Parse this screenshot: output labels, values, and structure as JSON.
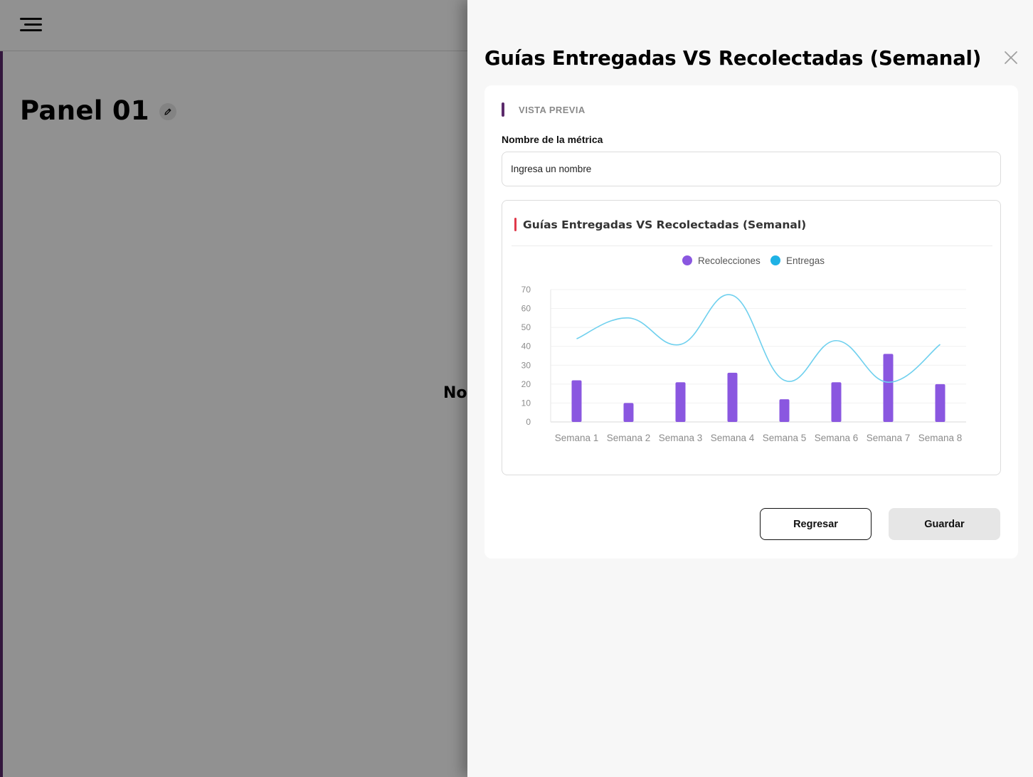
{
  "background": {
    "panel_title": "Panel 01",
    "center_message": "No"
  },
  "drawer": {
    "title": "Guías Entregadas VS Recolectadas (Semanal)",
    "section_label": "VISTA PREVIA",
    "metric_name_label": "Nombre de la métrica",
    "metric_name_placeholder": "Ingresa un nombre",
    "back_button": "Regresar",
    "save_button": "Guardar"
  },
  "colors": {
    "accent": "#5b2a6b",
    "chart_header_accent": "#e0394b",
    "recolecciones": "#8a57e0",
    "entregas": "#1fb2e5"
  },
  "chart_data": {
    "type": "bar",
    "title": "Guías Entregadas VS Recolectadas (Semanal)",
    "categories": [
      "Semana 1",
      "Semana 2",
      "Semana 3",
      "Semana 4",
      "Semana 5",
      "Semana 6",
      "Semana 7",
      "Semana 8"
    ],
    "series": [
      {
        "name": "Recolecciones",
        "type": "bar",
        "color": "#8a57e0",
        "values": [
          22,
          10,
          21,
          26,
          12,
          21,
          36,
          20
        ]
      },
      {
        "name": "Entregas",
        "type": "line",
        "color": "#1fb2e5",
        "values": [
          44,
          55,
          41,
          67,
          22,
          43,
          21,
          41
        ]
      }
    ],
    "yticks": [
      0,
      10,
      20,
      30,
      40,
      50,
      60,
      70
    ],
    "ylim": [
      0,
      70
    ],
    "xlabel": "",
    "ylabel": "",
    "legend": "top-center",
    "grid": true
  }
}
